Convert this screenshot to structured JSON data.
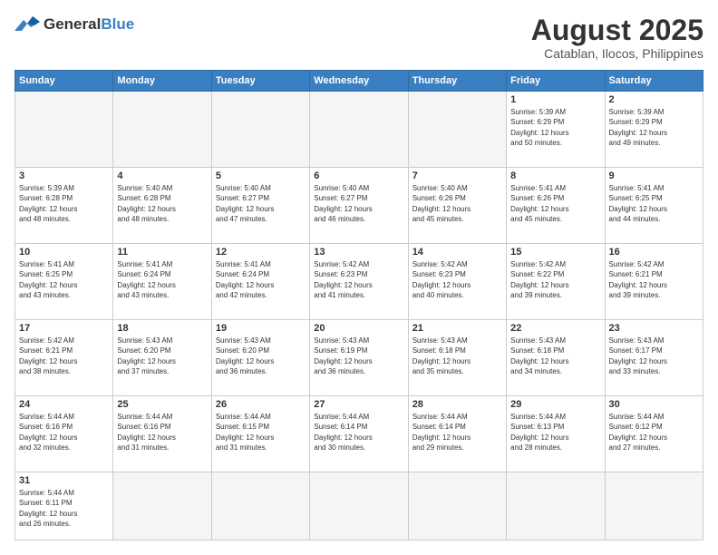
{
  "header": {
    "logo_general": "General",
    "logo_blue": "Blue",
    "month_year": "August 2025",
    "location": "Catablan, Ilocos, Philippines"
  },
  "weekdays": [
    "Sunday",
    "Monday",
    "Tuesday",
    "Wednesday",
    "Thursday",
    "Friday",
    "Saturday"
  ],
  "weeks": [
    [
      {
        "day": "",
        "info": ""
      },
      {
        "day": "",
        "info": ""
      },
      {
        "day": "",
        "info": ""
      },
      {
        "day": "",
        "info": ""
      },
      {
        "day": "",
        "info": ""
      },
      {
        "day": "1",
        "info": "Sunrise: 5:39 AM\nSunset: 6:29 PM\nDaylight: 12 hours\nand 50 minutes."
      },
      {
        "day": "2",
        "info": "Sunrise: 5:39 AM\nSunset: 6:29 PM\nDaylight: 12 hours\nand 49 minutes."
      }
    ],
    [
      {
        "day": "3",
        "info": "Sunrise: 5:39 AM\nSunset: 6:28 PM\nDaylight: 12 hours\nand 48 minutes."
      },
      {
        "day": "4",
        "info": "Sunrise: 5:40 AM\nSunset: 6:28 PM\nDaylight: 12 hours\nand 48 minutes."
      },
      {
        "day": "5",
        "info": "Sunrise: 5:40 AM\nSunset: 6:27 PM\nDaylight: 12 hours\nand 47 minutes."
      },
      {
        "day": "6",
        "info": "Sunrise: 5:40 AM\nSunset: 6:27 PM\nDaylight: 12 hours\nand 46 minutes."
      },
      {
        "day": "7",
        "info": "Sunrise: 5:40 AM\nSunset: 6:26 PM\nDaylight: 12 hours\nand 45 minutes."
      },
      {
        "day": "8",
        "info": "Sunrise: 5:41 AM\nSunset: 6:26 PM\nDaylight: 12 hours\nand 45 minutes."
      },
      {
        "day": "9",
        "info": "Sunrise: 5:41 AM\nSunset: 6:25 PM\nDaylight: 12 hours\nand 44 minutes."
      }
    ],
    [
      {
        "day": "10",
        "info": "Sunrise: 5:41 AM\nSunset: 6:25 PM\nDaylight: 12 hours\nand 43 minutes."
      },
      {
        "day": "11",
        "info": "Sunrise: 5:41 AM\nSunset: 6:24 PM\nDaylight: 12 hours\nand 43 minutes."
      },
      {
        "day": "12",
        "info": "Sunrise: 5:41 AM\nSunset: 6:24 PM\nDaylight: 12 hours\nand 42 minutes."
      },
      {
        "day": "13",
        "info": "Sunrise: 5:42 AM\nSunset: 6:23 PM\nDaylight: 12 hours\nand 41 minutes."
      },
      {
        "day": "14",
        "info": "Sunrise: 5:42 AM\nSunset: 6:23 PM\nDaylight: 12 hours\nand 40 minutes."
      },
      {
        "day": "15",
        "info": "Sunrise: 5:42 AM\nSunset: 6:22 PM\nDaylight: 12 hours\nand 39 minutes."
      },
      {
        "day": "16",
        "info": "Sunrise: 5:42 AM\nSunset: 6:21 PM\nDaylight: 12 hours\nand 39 minutes."
      }
    ],
    [
      {
        "day": "17",
        "info": "Sunrise: 5:42 AM\nSunset: 6:21 PM\nDaylight: 12 hours\nand 38 minutes."
      },
      {
        "day": "18",
        "info": "Sunrise: 5:43 AM\nSunset: 6:20 PM\nDaylight: 12 hours\nand 37 minutes."
      },
      {
        "day": "19",
        "info": "Sunrise: 5:43 AM\nSunset: 6:20 PM\nDaylight: 12 hours\nand 36 minutes."
      },
      {
        "day": "20",
        "info": "Sunrise: 5:43 AM\nSunset: 6:19 PM\nDaylight: 12 hours\nand 36 minutes."
      },
      {
        "day": "21",
        "info": "Sunrise: 5:43 AM\nSunset: 6:18 PM\nDaylight: 12 hours\nand 35 minutes."
      },
      {
        "day": "22",
        "info": "Sunrise: 5:43 AM\nSunset: 6:18 PM\nDaylight: 12 hours\nand 34 minutes."
      },
      {
        "day": "23",
        "info": "Sunrise: 5:43 AM\nSunset: 6:17 PM\nDaylight: 12 hours\nand 33 minutes."
      }
    ],
    [
      {
        "day": "24",
        "info": "Sunrise: 5:44 AM\nSunset: 6:16 PM\nDaylight: 12 hours\nand 32 minutes."
      },
      {
        "day": "25",
        "info": "Sunrise: 5:44 AM\nSunset: 6:16 PM\nDaylight: 12 hours\nand 31 minutes."
      },
      {
        "day": "26",
        "info": "Sunrise: 5:44 AM\nSunset: 6:15 PM\nDaylight: 12 hours\nand 31 minutes."
      },
      {
        "day": "27",
        "info": "Sunrise: 5:44 AM\nSunset: 6:14 PM\nDaylight: 12 hours\nand 30 minutes."
      },
      {
        "day": "28",
        "info": "Sunrise: 5:44 AM\nSunset: 6:14 PM\nDaylight: 12 hours\nand 29 minutes."
      },
      {
        "day": "29",
        "info": "Sunrise: 5:44 AM\nSunset: 6:13 PM\nDaylight: 12 hours\nand 28 minutes."
      },
      {
        "day": "30",
        "info": "Sunrise: 5:44 AM\nSunset: 6:12 PM\nDaylight: 12 hours\nand 27 minutes."
      }
    ],
    [
      {
        "day": "31",
        "info": "Sunrise: 5:44 AM\nSunset: 6:11 PM\nDaylight: 12 hours\nand 26 minutes."
      },
      {
        "day": "",
        "info": ""
      },
      {
        "day": "",
        "info": ""
      },
      {
        "day": "",
        "info": ""
      },
      {
        "day": "",
        "info": ""
      },
      {
        "day": "",
        "info": ""
      },
      {
        "day": "",
        "info": ""
      }
    ]
  ]
}
